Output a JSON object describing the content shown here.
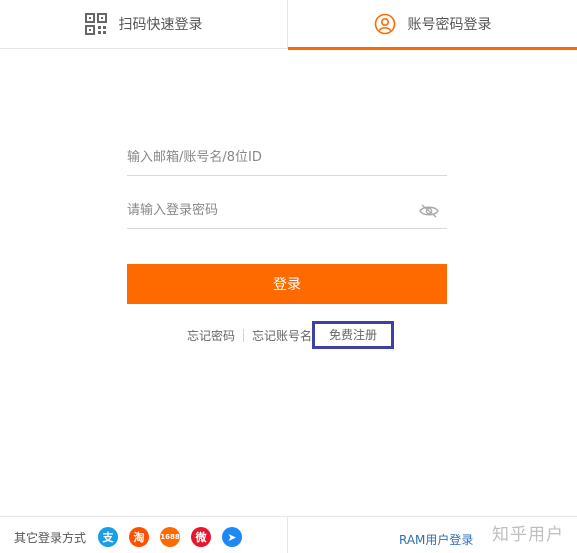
{
  "tabs": [
    {
      "label": "扫码快速登录",
      "icon": "qr-code-icon",
      "active": false
    },
    {
      "label": "账号密码登录",
      "icon": "user-icon",
      "active": true
    }
  ],
  "form": {
    "account_placeholder": "输入邮箱/账号名/8位ID",
    "password_placeholder": "请输入登录密码",
    "login_label": "登录"
  },
  "links": {
    "forgot_password": "忘记密码",
    "forgot_account": "忘记账号名",
    "register": "免费注册"
  },
  "footer": {
    "other_login_label": "其它登录方式",
    "social": [
      {
        "name": "alipay",
        "glyph": "支",
        "color": "#1a9ee6"
      },
      {
        "name": "taobao",
        "glyph": "淘",
        "color": "#ff5000"
      },
      {
        "name": "1688",
        "glyph": "1688",
        "color": "#ff6a00"
      },
      {
        "name": "weibo",
        "glyph": "微",
        "color": "#e6162d"
      },
      {
        "name": "dingtalk",
        "glyph": "➤",
        "color": "#1e89f5"
      }
    ],
    "ram_login": "RAM用户登录"
  },
  "watermark": "知乎用户",
  "colors": {
    "accent": "#ff6a00",
    "highlight_box": "#3f3fa8",
    "link": "#2f6fb5"
  }
}
